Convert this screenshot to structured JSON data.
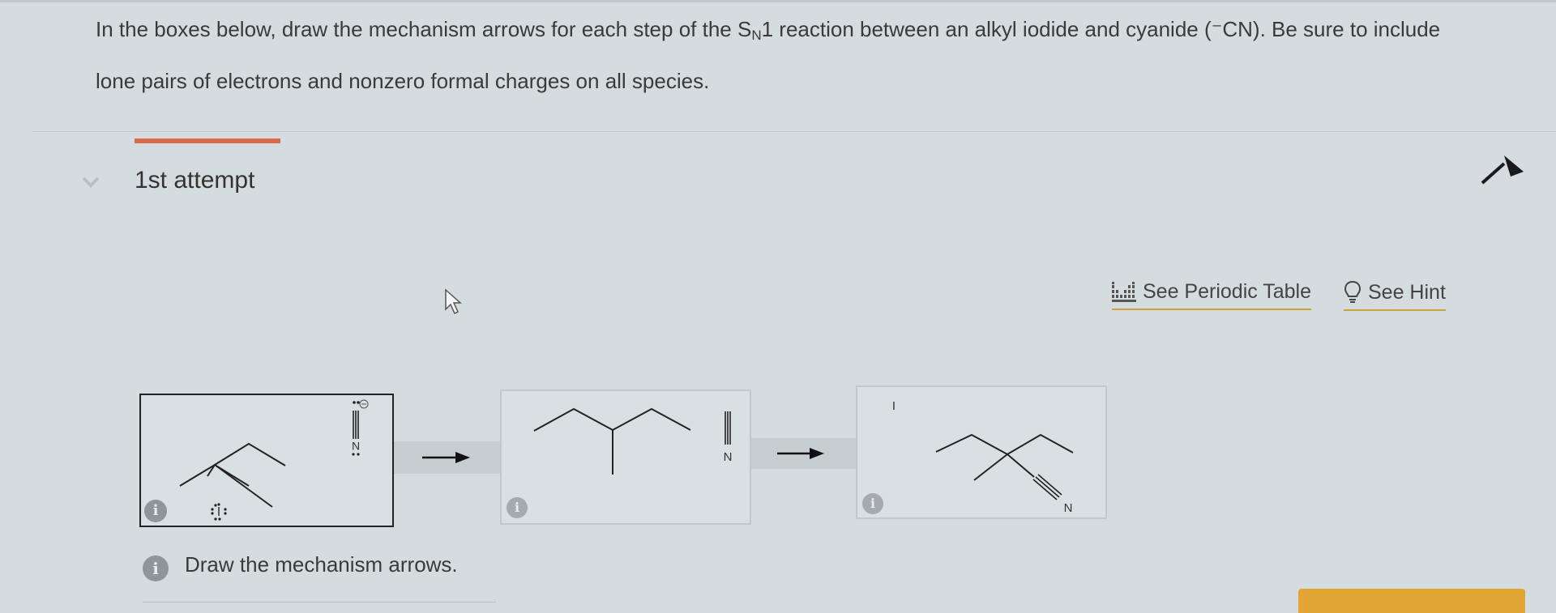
{
  "question": {
    "text_before": "In the boxes below, draw the mechanism arrows for each step of the S",
    "subscript": "N",
    "text_after": "1 reaction between an alkyl iodide and cyanide (⁻CN). Be sure to include lone pairs of electrons and nonzero formal charges on all species."
  },
  "attempt": {
    "title": "1st attempt"
  },
  "tools": {
    "periodic_table": "See Periodic Table",
    "hint": "See Hint"
  },
  "panels": {
    "step1": {
      "cyanide_n_label": "N",
      "iodine_label": "I",
      "info": "i"
    },
    "step2": {
      "cyanide_n_label": "N",
      "info": "i"
    },
    "step3": {
      "iodide_label": "I",
      "nitrile_n_label": "N",
      "info": "i"
    }
  },
  "instruction": {
    "icon": "i",
    "text": "Draw the mechanism arrows."
  },
  "colors": {
    "accent": "#d86a4e",
    "submit": "#e2a634",
    "underline": "#c9a23c"
  }
}
